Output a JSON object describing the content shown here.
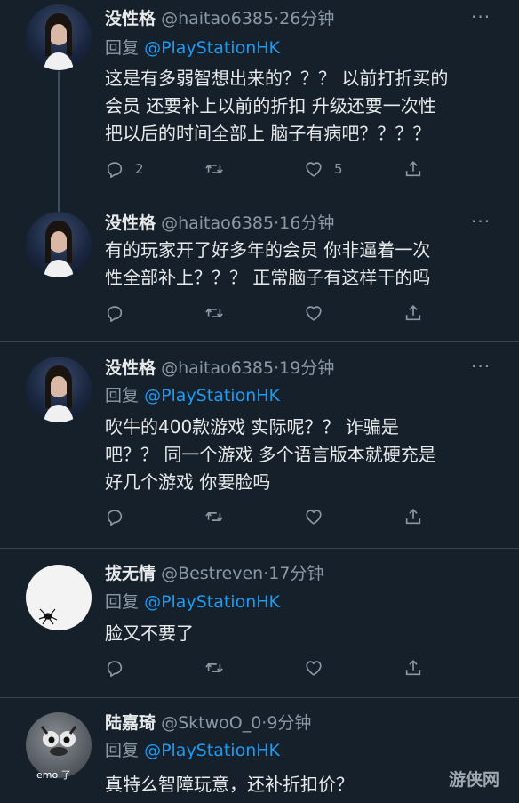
{
  "tweets": [
    {
      "name": "没性格",
      "handle": "@haitao6385",
      "dot": "·",
      "time": "26分钟",
      "reply_label": "回复",
      "reply_to": "@PlayStationHK",
      "lines": [
        "这是有多弱智想出来的？？？ 以前打折买的",
        "会员 还要补上以前的折扣  升级还要一次性",
        "把以后的时间全部上   脑子有病吧？？？？"
      ],
      "reply_count": "2",
      "retweet_count": "",
      "like_count": "5"
    },
    {
      "name": "没性格",
      "handle": "@haitao6385",
      "dot": "·",
      "time": "16分钟",
      "lines": [
        "有的玩家开了好多年的会员  你非逼着一次",
        "性全部补上？？？ 正常脑子有这样干的吗"
      ],
      "reply_count": "",
      "retweet_count": "",
      "like_count": ""
    },
    {
      "name": "没性格",
      "handle": "@haitao6385",
      "dot": "·",
      "time": "19分钟",
      "reply_label": "回复",
      "reply_to": "@PlayStationHK",
      "lines": [
        "吹牛的400款游戏  实际呢？？ 诈骗是",
        "吧？？   同一个游戏 多个语言版本就硬充是",
        "好几个游戏  你要脸吗"
      ],
      "reply_count": "",
      "retweet_count": "",
      "like_count": ""
    },
    {
      "name": "拔无情",
      "handle": "@Bestreven",
      "dot": "·",
      "time": "17分钟",
      "reply_label": "回复",
      "reply_to": "@PlayStationHK",
      "lines": [
        "脸又不要了"
      ],
      "reply_count": "",
      "retweet_count": "",
      "like_count": ""
    },
    {
      "name": "陆嘉琦",
      "handle": "@SktwoO_0",
      "dot": "·",
      "time": "9分钟",
      "reply_label": "回复",
      "reply_to": "@PlayStationHK",
      "lines": [
        "真特么智障玩意，还补折扣价？"
      ],
      "avatar_text": "emo 了"
    }
  ],
  "watermark": "游侠网",
  "icons": {
    "reply": "reply-icon",
    "retweet": "retweet-icon",
    "like": "heart-icon",
    "share": "share-icon",
    "more": "more-icon"
  },
  "colors": {
    "background": "#15202b",
    "link": "#1d9bf0",
    "secondary_text": "#8b98a5",
    "divider": "#38444d"
  }
}
